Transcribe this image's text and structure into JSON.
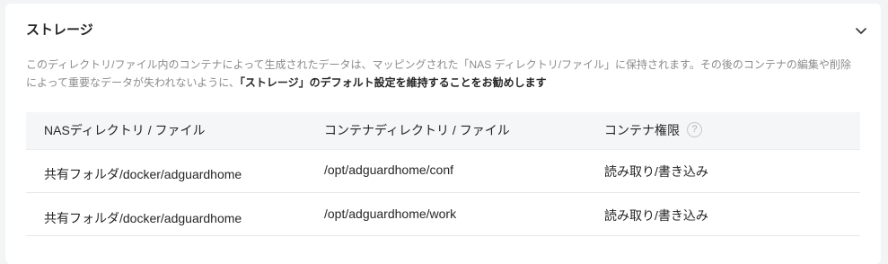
{
  "storage": {
    "title": "ストレージ",
    "collapse_icon": "chevron-down-icon",
    "description": {
      "text": "このディレクトリ/ファイル内のコンテナによって生成されたデータは、マッピングされた「NAS ディレクトリ/ファイル」に保持されます。その後のコンテナの編集や削除によって重要なデータが失われないように、",
      "emphasis": "「ストレージ」のデフォルト設定を維持することをお勧めします"
    },
    "table": {
      "headers": {
        "nas": "NASディレクトリ / ファイル",
        "container": "コンテナディレクトリ / ファイル",
        "permission": "コンテナ権限"
      },
      "help_icon": "question-circle-icon",
      "help_glyph": "?",
      "rows": [
        {
          "nas": "共有フォルダ/docker/adguardhome",
          "container": "/opt/adguardhome/conf",
          "permission": "読み取り/書き込み"
        },
        {
          "nas": "共有フォルダ/docker/adguardhome",
          "container": "/opt/adguardhome/work",
          "permission": "読み取り/書き込み"
        }
      ]
    }
  }
}
